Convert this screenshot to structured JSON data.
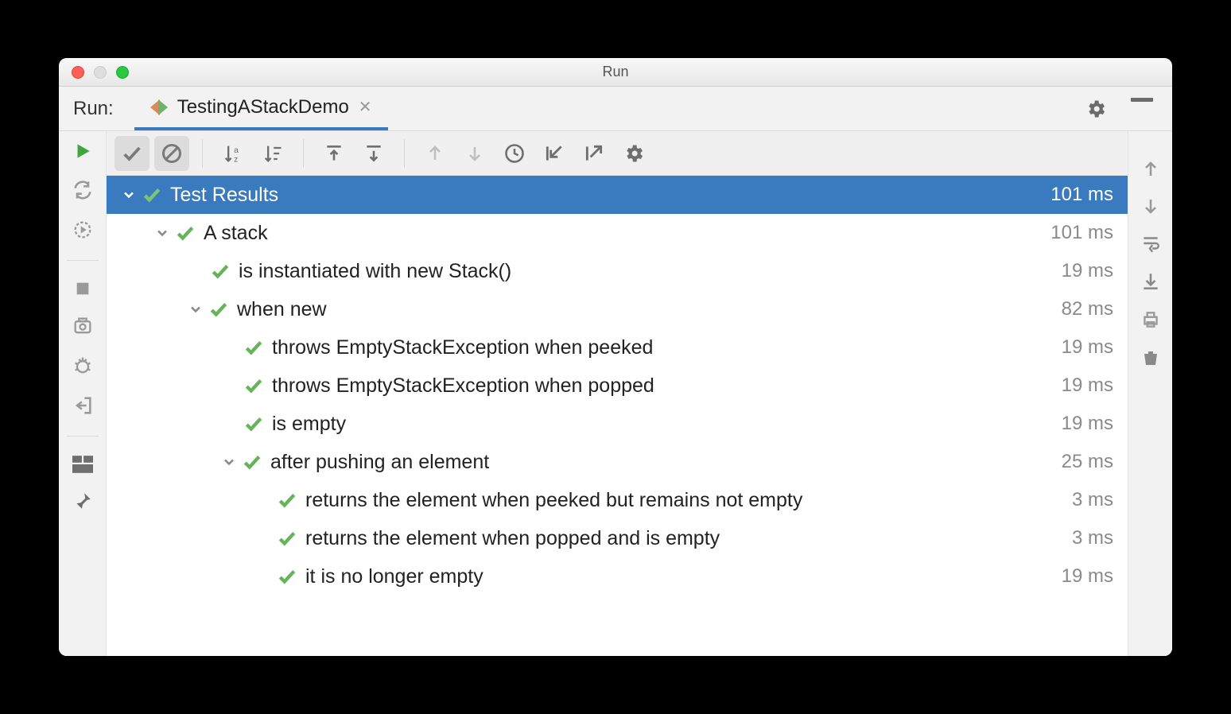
{
  "window": {
    "title": "Run"
  },
  "panel": {
    "label": "Run:"
  },
  "tab": {
    "name": "TestingAStackDemo"
  },
  "tree": {
    "root": {
      "label": "Test Results",
      "time": "101 ms"
    },
    "n1": {
      "label": "A stack",
      "time": "101 ms"
    },
    "n1_1": {
      "label": "is instantiated with new Stack()",
      "time": "19 ms"
    },
    "n1_2": {
      "label": "when new",
      "time": "82 ms"
    },
    "n1_2_1": {
      "label": "throws EmptyStackException when peeked",
      "time": "19 ms"
    },
    "n1_2_2": {
      "label": "throws EmptyStackException when popped",
      "time": "19 ms"
    },
    "n1_2_3": {
      "label": "is empty",
      "time": "19 ms"
    },
    "n1_3": {
      "label": "after pushing an element",
      "time": "25 ms"
    },
    "n1_3_1": {
      "label": "returns the element when peeked but remains not empty",
      "time": "3 ms"
    },
    "n1_3_2": {
      "label": "returns the element when popped and is empty",
      "time": "3 ms"
    },
    "n1_3_3": {
      "label": "it is no longer empty",
      "time": "19 ms"
    }
  }
}
